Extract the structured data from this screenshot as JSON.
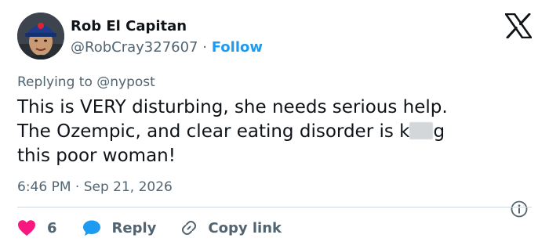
{
  "author": {
    "display_name": "Rob El Capitan",
    "handle": "@RobCray327607",
    "separator": "·",
    "follow_label": "Follow"
  },
  "reply_to": {
    "prefix": "Replying to",
    "mention": "@nypost"
  },
  "tweet": {
    "line1": "This is VERY disturbing, she needs serious help.",
    "line2_before": "The Ozempic, and clear eating disorder is k",
    "line2_after": "g",
    "line3": "this poor woman!"
  },
  "timestamp": "6:46 PM · Sep 21, 2026",
  "actions": {
    "like_count": "6",
    "reply_label": "Reply",
    "copy_label": "Copy link"
  },
  "icons": {
    "like": "heart-icon",
    "reply": "speech-bubble-icon",
    "copy": "link-icon",
    "info": "info-icon",
    "logo": "x-logo-icon"
  },
  "colors": {
    "accent": "#1d9bf0",
    "like": "#f91880",
    "text": "#0f1419",
    "muted": "#536471"
  }
}
